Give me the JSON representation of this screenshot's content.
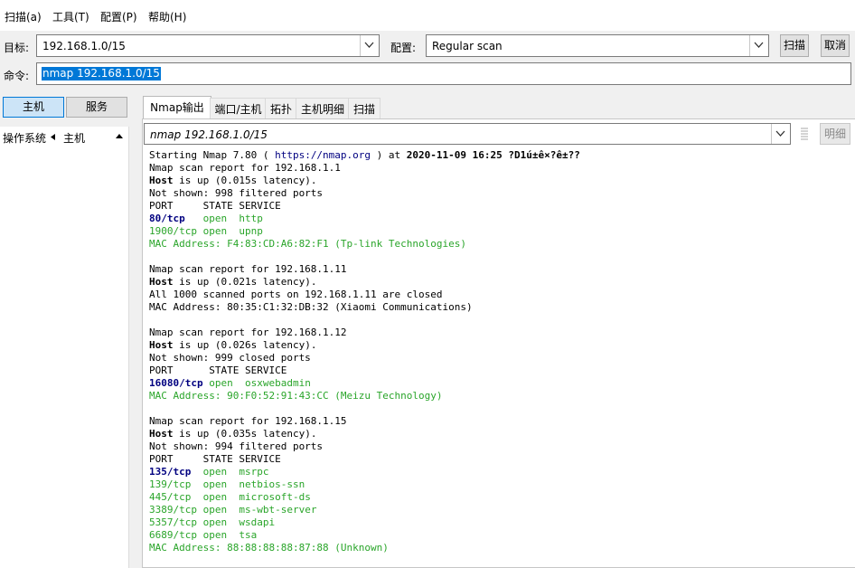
{
  "menu": {
    "scan": "扫描(a)",
    "tools": "工具(T)",
    "profile": "配置(P)",
    "help": "帮助(H)"
  },
  "toolbar": {
    "target_label": "目标:",
    "target_value": "192.168.1.0/15",
    "profile_label": "配置:",
    "profile_value": "Regular scan",
    "scan_button": "扫描",
    "cancel_button": "取消",
    "command_label": "命令:",
    "command_value": "nmap 192.168.1.0/15"
  },
  "left_panel": {
    "hosts_button": "主机",
    "services_button": "服务",
    "os_column": "操作系统",
    "host_column": "主机"
  },
  "tabs": [
    "Nmap输出",
    "端口/主机",
    "拓扑",
    "主机明细",
    "扫描"
  ],
  "output_panel": {
    "command": "nmap 192.168.1.0/15",
    "details_button": "明细"
  },
  "output": {
    "line1_a": "Starting Nmap 7.80 ( ",
    "line1_url": "https://nmap.org",
    "line1_b": " ) at ",
    "line1_date": "2020-11-09 16:25 ?D1ú±ê×?ê±??",
    "hosts": [
      {
        "report": "Nmap scan report for 192.168.1.1",
        "status_a": "Host",
        "status_b": " is up (0.015s latency).",
        "not_shown": "Not shown: 998 filtered ports",
        "header": "PORT     STATE SERVICE",
        "ports": [
          {
            "port": "80/tcp",
            "gap": "   ",
            "state": "open",
            "service": "http"
          },
          {
            "port": "1900/tcp",
            "gap": " ",
            "state": "open",
            "service": "upnp"
          }
        ],
        "mac": "MAC Address: F4:83:CD:A6:82:F1 (Tp-link Technologies)"
      },
      {
        "report": "Nmap scan report for 192.168.1.11",
        "status_a": "Host",
        "status_b": " is up (0.021s latency).",
        "all_closed": "All 1000 scanned ports on 192.168.1.11 are closed",
        "mac": "MAC Address: 80:35:C1:32:DB:32 (Xiaomi Communications)"
      },
      {
        "report": "Nmap scan report for 192.168.1.12",
        "status_a": "Host",
        "status_b": " is up (0.026s latency).",
        "not_shown": "Not shown: 999 closed ports",
        "header": "PORT      STATE SERVICE",
        "ports": [
          {
            "port": "16080/tcp",
            "gap": " ",
            "state": "open",
            "service": "osxwebadmin"
          }
        ],
        "mac": "MAC Address: 90:F0:52:91:43:CC (Meizu Technology)"
      },
      {
        "report": "Nmap scan report for 192.168.1.15",
        "status_a": "Host",
        "status_b": " is up (0.035s latency).",
        "not_shown": "Not shown: 994 filtered ports",
        "header": "PORT     STATE SERVICE",
        "ports": [
          {
            "port": "135/tcp",
            "gap": "  ",
            "state": "open",
            "service": "msrpc"
          },
          {
            "port": "139/tcp",
            "gap": "  ",
            "state": "open",
            "service": "netbios-ssn"
          },
          {
            "port": "445/tcp",
            "gap": "  ",
            "state": "open",
            "service": "microsoft-ds"
          },
          {
            "port": "3389/tcp",
            "gap": " ",
            "state": "open",
            "service": "ms-wbt-server"
          },
          {
            "port": "5357/tcp",
            "gap": " ",
            "state": "open",
            "service": "wsdapi"
          },
          {
            "port": "6689/tcp",
            "gap": " ",
            "state": "open",
            "service": "tsa"
          }
        ],
        "mac": "MAC Address: 88:88:88:88:87:88 (Unknown)"
      }
    ]
  },
  "colors": {
    "accent": "#0078d7",
    "port_blue": "#000080",
    "open_green": "#2aa52a"
  }
}
